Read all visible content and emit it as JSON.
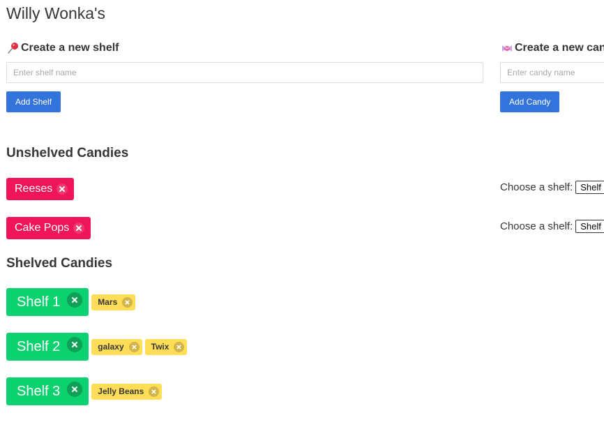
{
  "app": {
    "title": "Willy Wonka's"
  },
  "shelf_form": {
    "icon": "pushpin-icon",
    "heading": "Create a new shelf",
    "placeholder": "Enter shelf name",
    "value": "",
    "button_label": "Add Shelf"
  },
  "candy_form": {
    "icon": "candy-icon",
    "heading": "Create a new candy",
    "placeholder": "Enter candy name",
    "value": "",
    "button_label": "Add Candy"
  },
  "unshelved": {
    "title": "Unshelved Candies",
    "choose_label": "Choose a shelf:",
    "select_value": "Shelf",
    "items": [
      {
        "name": "Reeses"
      },
      {
        "name": "Cake Pops"
      }
    ]
  },
  "shelved": {
    "title": "Shelved Candies",
    "shelves": [
      {
        "name": "Shelf 1",
        "candies": [
          "Mars"
        ]
      },
      {
        "name": "Shelf 2",
        "candies": [
          "galaxy",
          "Twix"
        ]
      },
      {
        "name": "Shelf 3",
        "candies": [
          "Jelly Beans"
        ]
      }
    ]
  },
  "colors": {
    "primary": "#3273dc",
    "danger": "#f0145a",
    "success": "#0bd16e",
    "warning": "#ffdd57"
  }
}
